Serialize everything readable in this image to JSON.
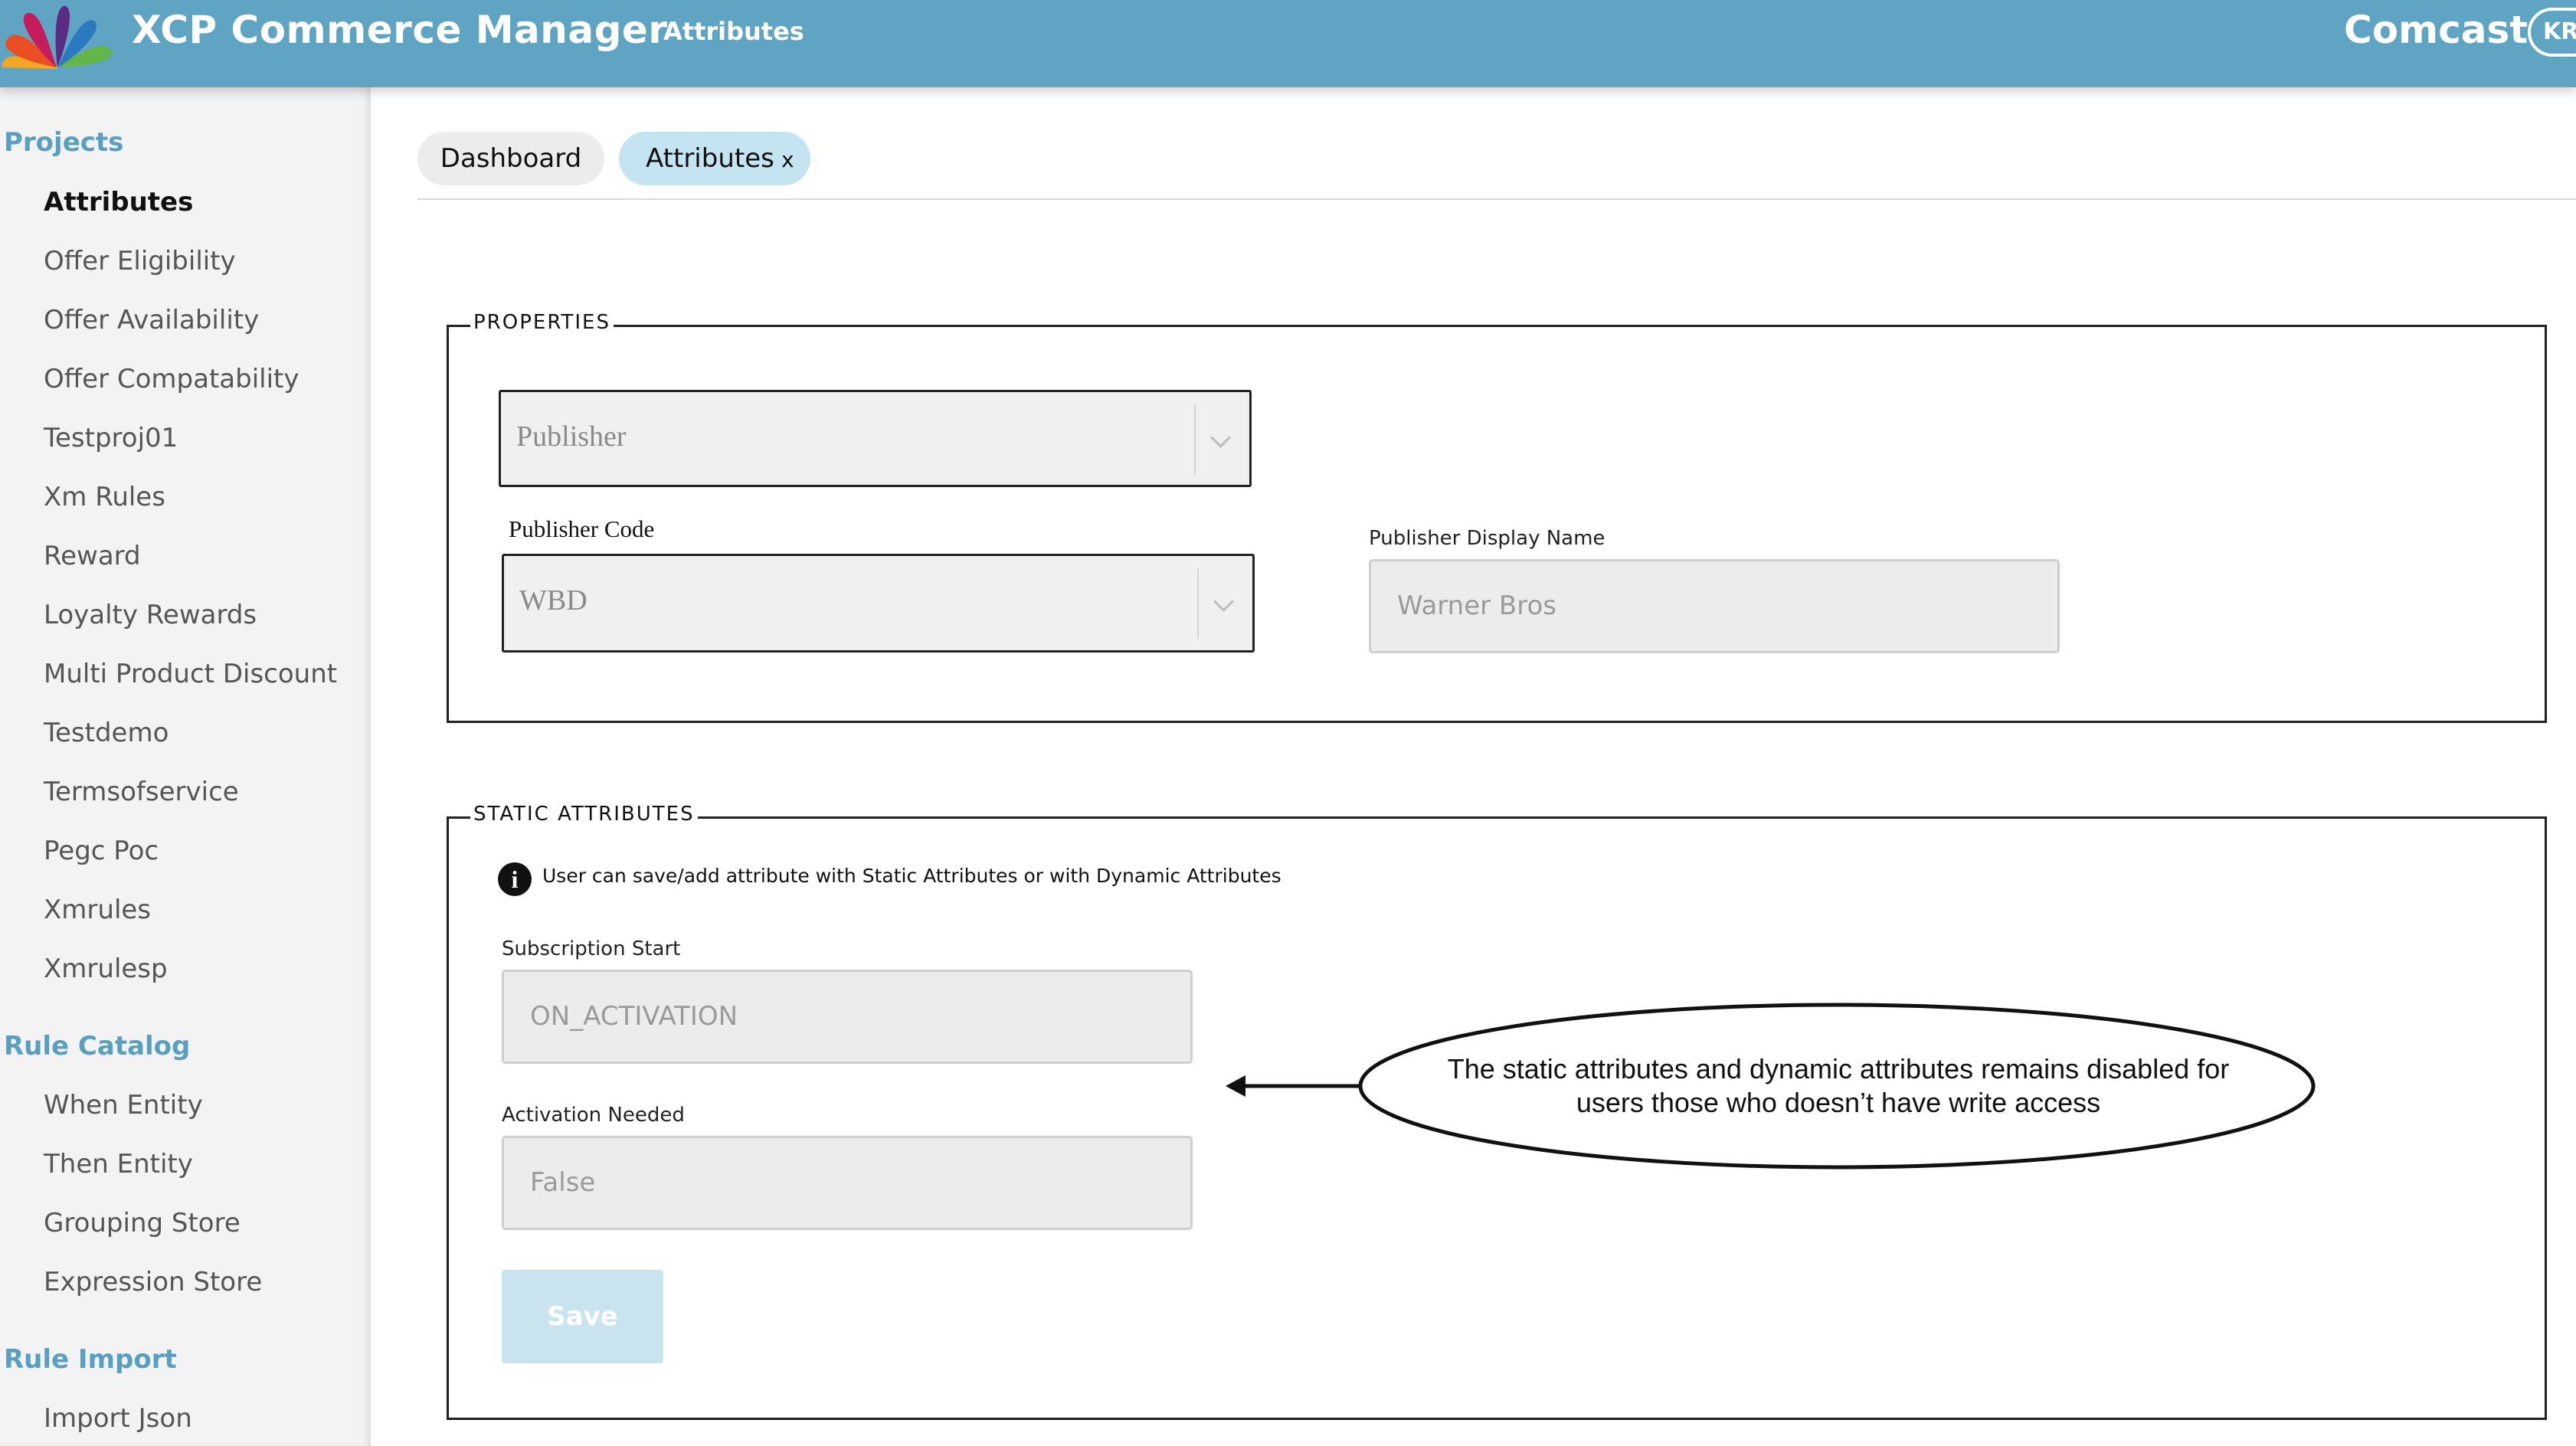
{
  "header": {
    "app_title": "XCP Commerce Manager",
    "nav_label": "Attributes",
    "brand": "Comcast",
    "user_initials": "KR",
    "background_color": "#5fa5c3"
  },
  "sidebar": {
    "sections": [
      {
        "title": "Projects",
        "items": [
          "Attributes",
          "Offer Eligibility",
          "Offer Availability",
          "Offer Compatability",
          "Testproj01",
          "Xm Rules",
          "Reward",
          "Loyalty Rewards",
          "Multi Product Discount",
          "Testdemo",
          "Termsofservice",
          "Pegc Poc",
          "Xmrules",
          "Xmrulesp"
        ]
      },
      {
        "title": "Rule Catalog",
        "items": [
          "When Entity",
          "Then Entity",
          "Grouping Store",
          "Expression Store"
        ]
      },
      {
        "title": "Rule Import",
        "items": [
          "Import Json"
        ]
      }
    ],
    "active_item": "Attributes",
    "accent_color": "#5a9fc0"
  },
  "tabs": {
    "dashboard": "Dashboard",
    "attributes": "Attributes",
    "close_symbol": "x"
  },
  "properties": {
    "legend": "PROPERTIES",
    "publisher_select": {
      "value": "Publisher",
      "icon": "chevron-down-icon"
    },
    "publisher_code": {
      "label": "Publisher Code",
      "value": "WBD",
      "icon": "chevron-down-icon"
    },
    "publisher_display_name": {
      "label": "Publisher Display Name",
      "value": "Warner Bros"
    }
  },
  "static_attributes": {
    "legend": "STATIC ATTRIBUTES",
    "info_icon": "i",
    "info_text": "User can save/add attribute with Static Attributes or with Dynamic Attributes",
    "subscription_start": {
      "label": "Subscription Start",
      "value": "ON_ACTIVATION"
    },
    "activation_needed": {
      "label": "Activation Needed",
      "value": "False"
    },
    "save_label": "Save"
  },
  "annotation": {
    "line1": "The static attributes and dynamic attributes remains disabled for",
    "line2": "users those who doesn’t have write access"
  }
}
